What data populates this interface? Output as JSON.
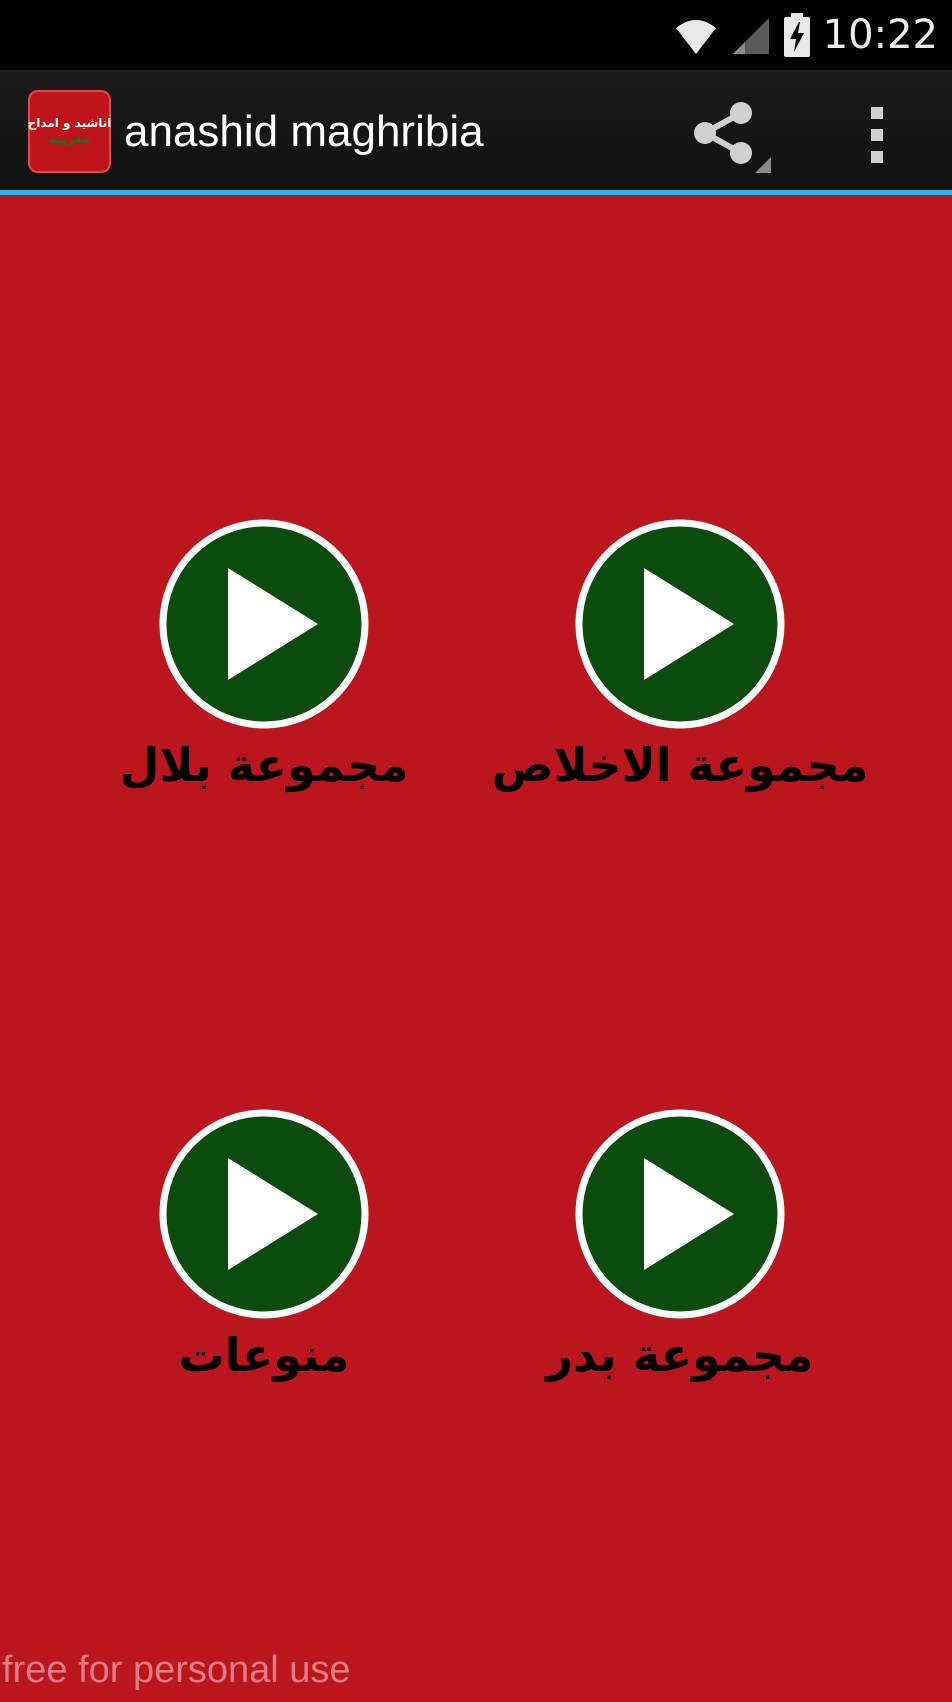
{
  "status_bar": {
    "time": "10:22",
    "icons": [
      "wifi-icon",
      "signal-icon",
      "battery-charging-icon"
    ]
  },
  "action_bar": {
    "app_icon_text_line1": "اناشيد و امداح",
    "app_icon_text_line2": "مغربية",
    "title": "anashid maghribia",
    "actions": [
      "share-icon",
      "overflow-menu-icon"
    ]
  },
  "groups": [
    {
      "label": "مجموعة بلال",
      "icon": "play-icon"
    },
    {
      "label": "مجموعة الاخلاص",
      "icon": "play-icon"
    },
    {
      "label": "منوعات",
      "icon": "play-icon"
    },
    {
      "label": "مجموعة بدر",
      "icon": "play-icon"
    }
  ],
  "watermark": "free for personal use",
  "colors": {
    "background": "#bb161e",
    "play_fill": "#0b4b0d",
    "play_ring": "#ffffff",
    "accent_line": "#33b5e5"
  }
}
